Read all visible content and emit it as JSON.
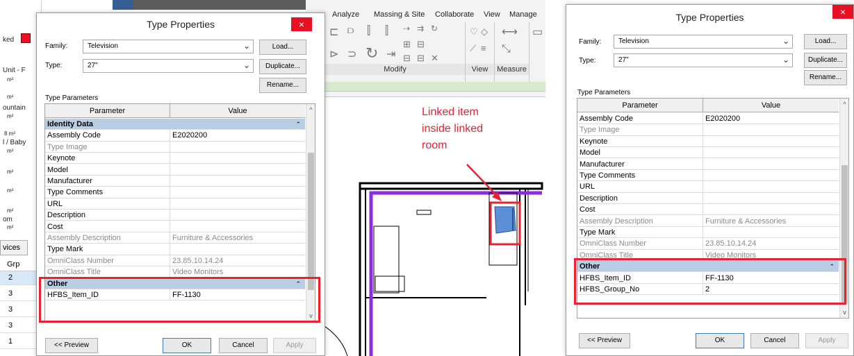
{
  "left_panel": {
    "texts": [
      "ked",
      "Unit - F",
      "m²",
      "m²",
      "ountain",
      "m²",
      "8 m²",
      "l / Baby",
      "m²",
      "m²",
      "m²",
      "m²",
      "om",
      "m²"
    ],
    "tab": "vices",
    "col_header": "Grp",
    "rows": [
      "2",
      "3",
      "3",
      "3",
      "1"
    ]
  },
  "ribbon": {
    "tabs": [
      "Analyze",
      "Massing & Site",
      "Collaborate",
      "View",
      "Manage"
    ],
    "panels": [
      "Modify",
      "View",
      "Measure"
    ]
  },
  "annotation": {
    "line1": "Linked item",
    "line2": "inside linked",
    "line3": "room"
  },
  "dialog_left": {
    "title": "Type Properties",
    "close_glyph": "×",
    "family_label": "Family:",
    "family_value": "Television",
    "type_label": "Type:",
    "type_value": "27\"",
    "load_button": "Load...",
    "duplicate_button": "Duplicate...",
    "rename_button": "Rename...",
    "type_parameters_label": "Type Parameters",
    "col_parameter": "Parameter",
    "col_value": "Value",
    "rows": [
      {
        "k": "Identity Data",
        "v": "",
        "kind": "section"
      },
      {
        "k": "Assembly Code",
        "v": "E2020200",
        "kind": "normal"
      },
      {
        "k": "Type Image",
        "v": "",
        "kind": "grey"
      },
      {
        "k": "Keynote",
        "v": "",
        "kind": "normal"
      },
      {
        "k": "Model",
        "v": "",
        "kind": "normal"
      },
      {
        "k": "Manufacturer",
        "v": "",
        "kind": "normal"
      },
      {
        "k": "Type Comments",
        "v": "",
        "kind": "normal"
      },
      {
        "k": "URL",
        "v": "",
        "kind": "normal"
      },
      {
        "k": "Description",
        "v": "",
        "kind": "normal"
      },
      {
        "k": "Cost",
        "v": "",
        "kind": "normal"
      },
      {
        "k": "Assembly Description",
        "v": "Furniture & Accessories",
        "kind": "grey"
      },
      {
        "k": "Type Mark",
        "v": "",
        "kind": "normal"
      },
      {
        "k": "OmniClass Number",
        "v": "23.85.10.14.24",
        "kind": "grey"
      },
      {
        "k": "OmniClass Title",
        "v": "Video Monitors",
        "kind": "grey"
      },
      {
        "k": "Other",
        "v": "",
        "kind": "section"
      },
      {
        "k": "HFBS_Item_ID",
        "v": "FF-1130",
        "kind": "normal"
      }
    ],
    "preview_button": "<< Preview",
    "ok_button": "OK",
    "cancel_button": "Cancel",
    "apply_button": "Apply"
  },
  "dialog_right": {
    "title": "Type Properties",
    "close_glyph": "×",
    "family_label": "Family:",
    "family_value": "Television",
    "type_label": "Type:",
    "type_value": "27\"",
    "load_button": "Load...",
    "duplicate_button": "Duplicate...",
    "rename_button": "Rename...",
    "type_parameters_label": "Type Parameters",
    "col_parameter": "Parameter",
    "col_value": "Value",
    "rows": [
      {
        "k": "Assembly Code",
        "v": "E2020200",
        "kind": "normal"
      },
      {
        "k": "Type Image",
        "v": "",
        "kind": "grey"
      },
      {
        "k": "Keynote",
        "v": "",
        "kind": "normal"
      },
      {
        "k": "Model",
        "v": "",
        "kind": "normal"
      },
      {
        "k": "Manufacturer",
        "v": "",
        "kind": "normal"
      },
      {
        "k": "Type Comments",
        "v": "",
        "kind": "normal"
      },
      {
        "k": "URL",
        "v": "",
        "kind": "normal"
      },
      {
        "k": "Description",
        "v": "",
        "kind": "normal"
      },
      {
        "k": "Cost",
        "v": "",
        "kind": "normal"
      },
      {
        "k": "Assembly Description",
        "v": "Furniture & Accessories",
        "kind": "grey"
      },
      {
        "k": "Type Mark",
        "v": "",
        "kind": "normal"
      },
      {
        "k": "OmniClass Number",
        "v": "23.85.10.14.24",
        "kind": "grey"
      },
      {
        "k": "OmniClass Title",
        "v": "Video Monitors",
        "kind": "grey"
      },
      {
        "k": "Other",
        "v": "",
        "kind": "section"
      },
      {
        "k": "HFBS_Item_ID",
        "v": "FF-1130",
        "kind": "normal"
      },
      {
        "k": "HFBS_Group_No",
        "v": "2",
        "kind": "normal"
      }
    ],
    "preview_button": "<< Preview",
    "ok_button": "OK",
    "cancel_button": "Cancel",
    "apply_button": "Apply"
  },
  "colors": {
    "highlight_red": "#e8232f",
    "section_blue": "#b9cde5",
    "wall_purple": "#8b2be2",
    "linked_item_blue": "#5b8fd6"
  }
}
